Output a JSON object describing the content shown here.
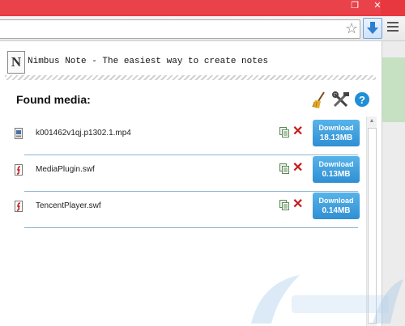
{
  "app": {
    "name": "Nimbus Note - The easiest way to create notes",
    "logo_letter": "N"
  },
  "section": {
    "title": "Found media:"
  },
  "media": [
    {
      "filename": "k001462v1qj.p1302.1.mp4",
      "type": "video",
      "download_label": "Download",
      "size": "18.13MB"
    },
    {
      "filename": "MediaPlugin.swf",
      "type": "flash",
      "download_label": "Download",
      "size": "0.13MB"
    },
    {
      "filename": "TencentPlayer.swf",
      "type": "flash",
      "download_label": "Download",
      "size": "0.14MB"
    }
  ],
  "window_controls": {
    "restore": "❐",
    "close": "✕"
  },
  "colors": {
    "chrome_red": "#e9373f",
    "download_button": "#3a9ad9",
    "delete": "#c61b1b",
    "separator": "#8ab3cf"
  },
  "icons": [
    "broom-icon",
    "tools-icon",
    "help-icon",
    "copy-icon",
    "delete-icon",
    "star-icon",
    "download-arrow-icon",
    "menu-icon",
    "video-file-icon",
    "flash-file-icon"
  ]
}
